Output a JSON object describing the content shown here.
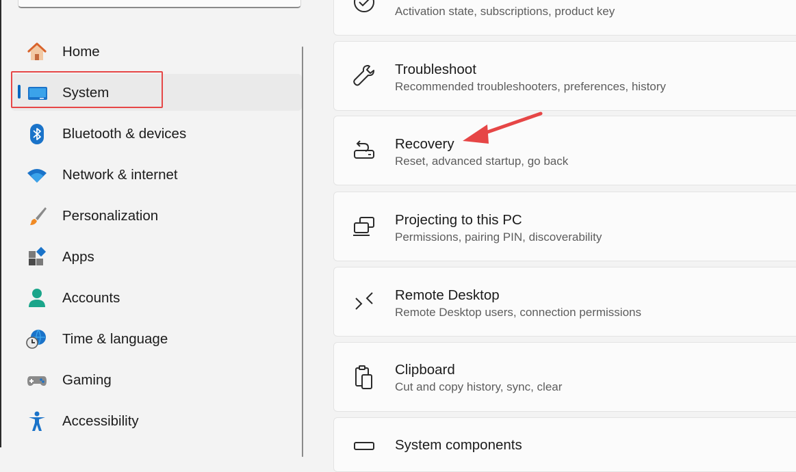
{
  "search": {
    "placeholder_fragment": ""
  },
  "sidebar": {
    "items": [
      {
        "label": "Home",
        "icon": "home-icon"
      },
      {
        "label": "System",
        "icon": "monitor-icon",
        "selected": true
      },
      {
        "label": "Bluetooth & devices",
        "icon": "bluetooth-icon"
      },
      {
        "label": "Network & internet",
        "icon": "wifi-icon"
      },
      {
        "label": "Personalization",
        "icon": "brush-icon"
      },
      {
        "label": "Apps",
        "icon": "apps-icon"
      },
      {
        "label": "Accounts",
        "icon": "person-icon"
      },
      {
        "label": "Time & language",
        "icon": "globe-clock-icon"
      },
      {
        "label": "Gaming",
        "icon": "gamepad-icon"
      },
      {
        "label": "Accessibility",
        "icon": "accessibility-icon"
      }
    ]
  },
  "main": {
    "cards": [
      {
        "title": "",
        "desc": "Activation state, subscriptions, product key",
        "icon": "activation-check-icon"
      },
      {
        "title": "Troubleshoot",
        "desc": "Recommended troubleshooters, preferences, history",
        "icon": "wrench-icon"
      },
      {
        "title": "Recovery",
        "desc": "Reset, advanced startup, go back",
        "icon": "recovery-icon"
      },
      {
        "title": "Projecting to this PC",
        "desc": "Permissions, pairing PIN, discoverability",
        "icon": "projecting-icon"
      },
      {
        "title": "Remote Desktop",
        "desc": "Remote Desktop users, connection permissions",
        "icon": "remote-desktop-icon"
      },
      {
        "title": "Clipboard",
        "desc": "Cut and copy history, sync, clear",
        "icon": "clipboard-icon"
      },
      {
        "title": "System components",
        "desc": "",
        "icon": "system-components-icon"
      }
    ]
  },
  "colors": {
    "accent": "#0067c0",
    "annotation": "#e64646"
  }
}
